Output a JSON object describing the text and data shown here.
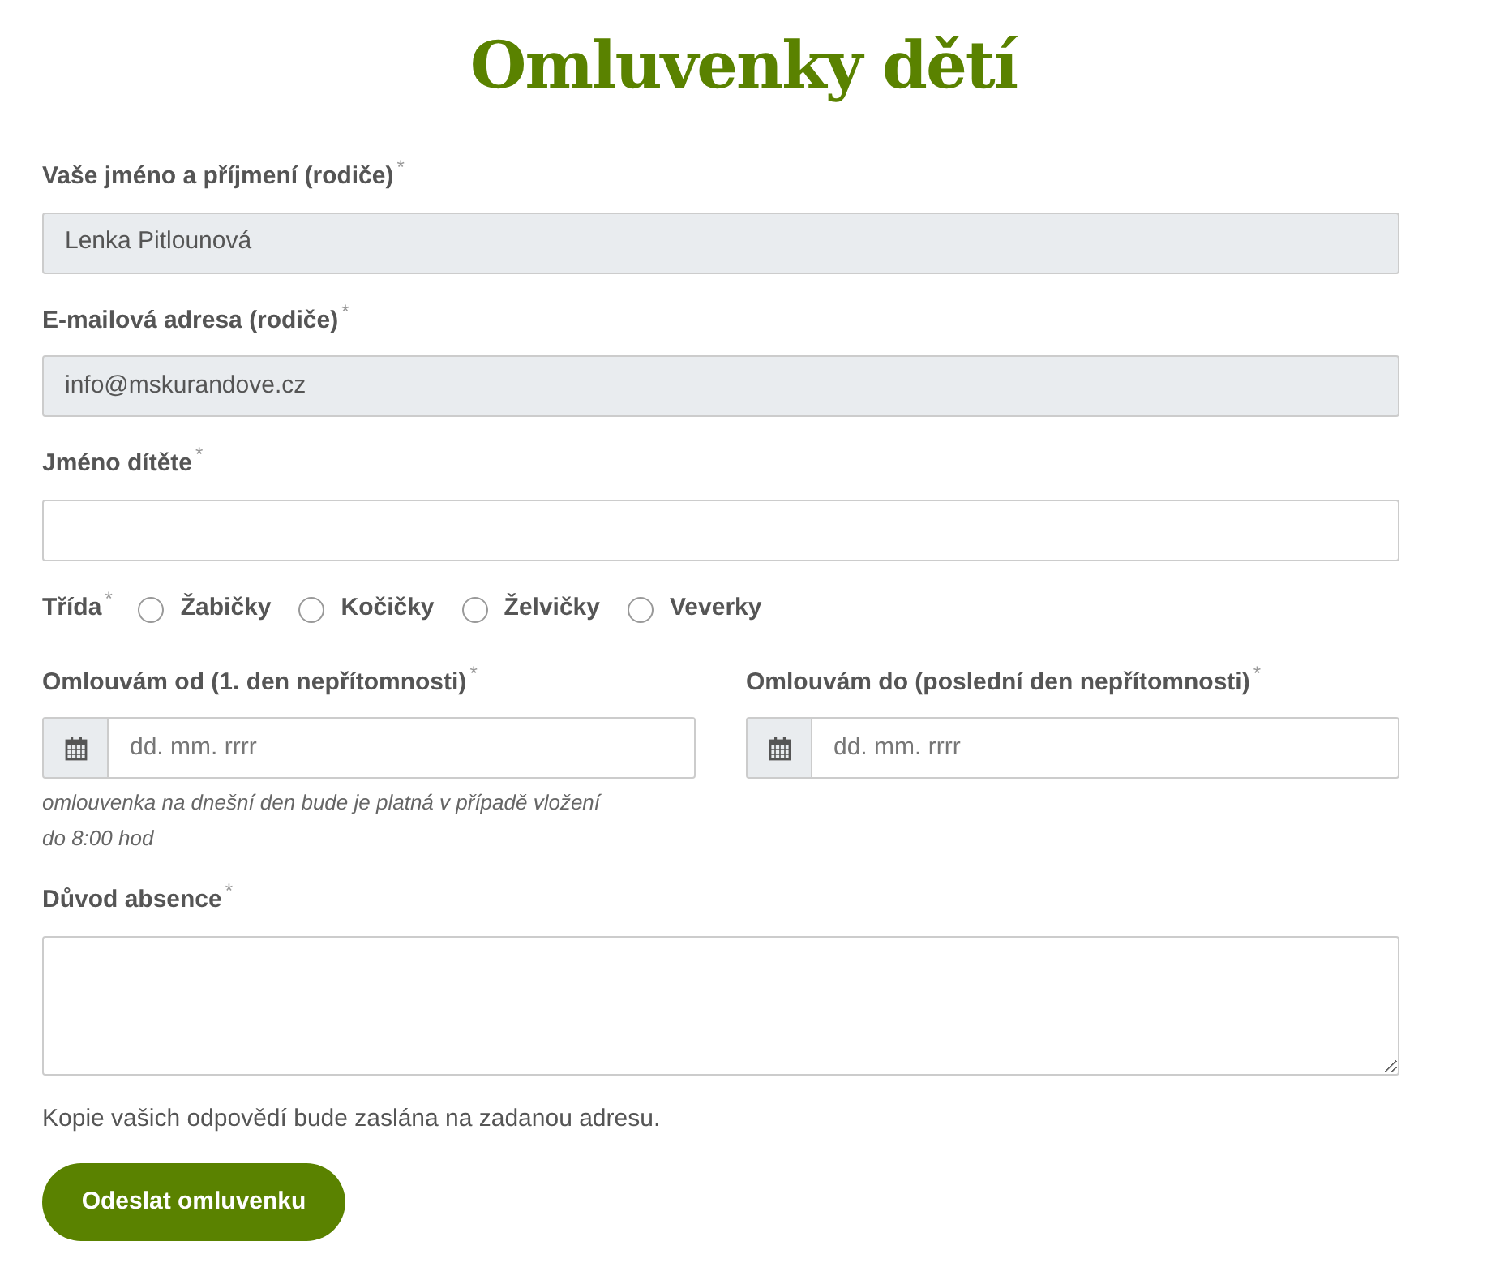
{
  "title": "Omluvenky dětí",
  "fields": [
    {
      "label": "Vaše jméno a příjmení (rodiče)",
      "required_mark": "*",
      "value": "Lenka Pitlounová",
      "readonly": true
    },
    {
      "label": "E-mailová adresa (rodiče)",
      "required_mark": "*",
      "value": "info@mskurandove.cz",
      "readonly": true
    },
    {
      "label": "Jméno dítěte",
      "required_mark": "*",
      "readonly": false
    }
  ],
  "class_group": {
    "label": "Třída",
    "required_mark": "*",
    "options": [
      {
        "label": "Žabičky",
        "selected": false
      },
      {
        "label": "Kočičky",
        "selected": false
      },
      {
        "label": "Želvičky",
        "selected": false
      },
      {
        "label": "Veverky",
        "selected": false
      }
    ]
  },
  "dates": [
    {
      "label": "Omlouvám od (1. den nepřítomnosti)",
      "required_mark": "*",
      "placeholder": "dd. mm. rrrr",
      "hint": "omlouvenka na dnešní den bude je platná v případě vložení do 8:00 hod"
    },
    {
      "label": "Omlouvám do (poslední den nepřítomnosti)",
      "required_mark": "*",
      "placeholder": "dd. mm. rrrr"
    }
  ],
  "reason": {
    "label": "Důvod absence",
    "required_mark": "*"
  },
  "note": "Kopie vašich odpovědí bude zaslána na zadanou adresu.",
  "submit": "Odeslat omluvenku"
}
